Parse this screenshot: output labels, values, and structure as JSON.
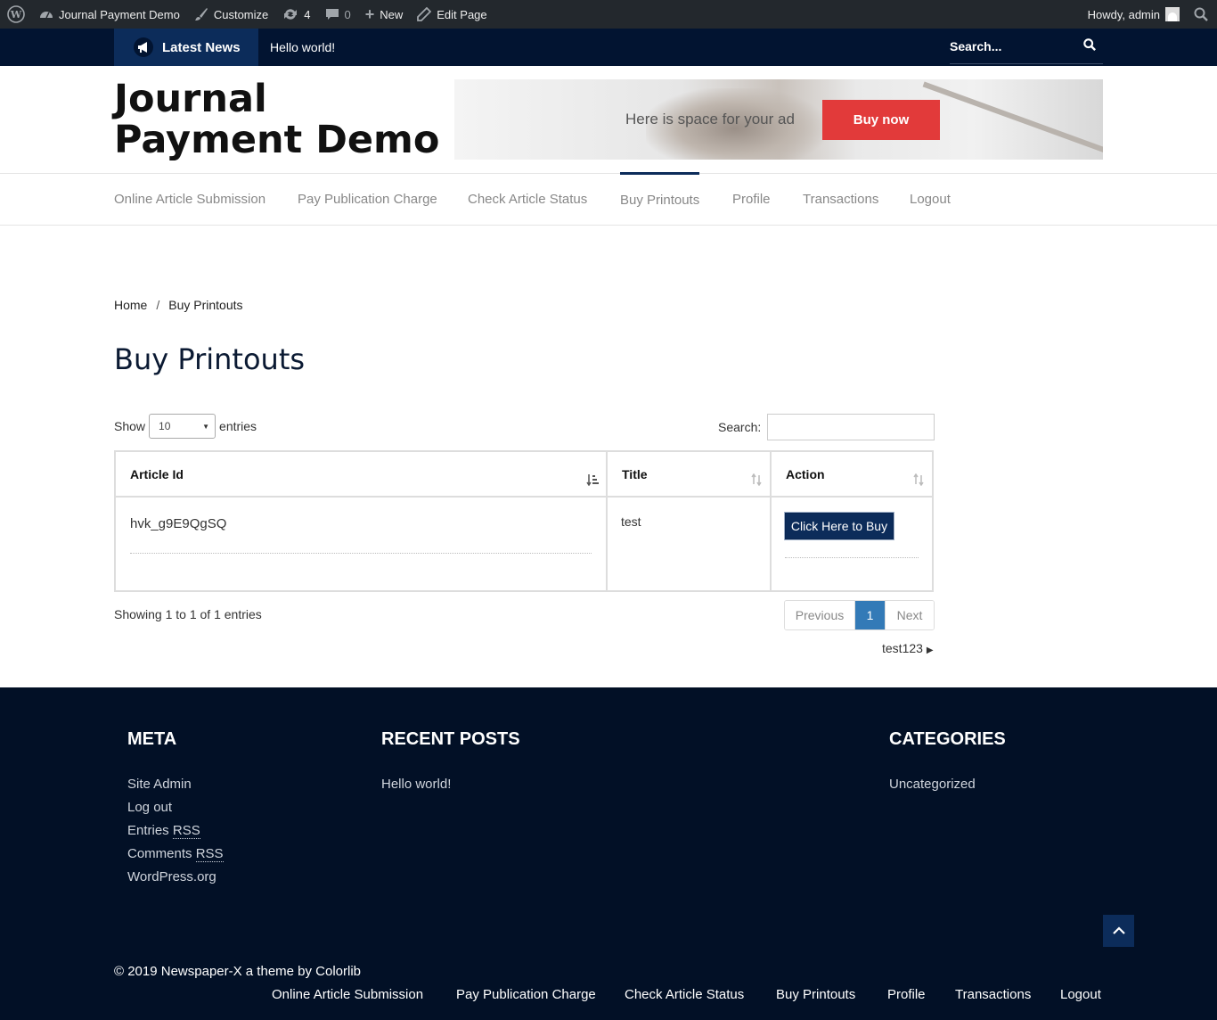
{
  "adminbar": {
    "site_name": "Journal Payment Demo",
    "customize": "Customize",
    "updates": "4",
    "comments": "0",
    "new": "New",
    "edit_page": "Edit Page",
    "howdy": "Howdy, admin"
  },
  "newsbar": {
    "latest_label": "Latest News",
    "ticker_text": "Hello world!",
    "search_placeholder": "Search..."
  },
  "header": {
    "site_title": "Journal Payment Demo",
    "ad_text": "Here is space for your ad",
    "ad_button": "Buy now"
  },
  "nav": [
    "Online Article Submission",
    "Pay Publication Charge",
    "Check Article Status",
    "Buy Printouts",
    "Profile",
    "Transactions",
    "Logout"
  ],
  "breadcrumb": {
    "home": "Home",
    "separator": "/",
    "current": "Buy Printouts"
  },
  "page_title": "Buy Printouts",
  "table_controls": {
    "show_label": "Show",
    "entries_value": "10",
    "entries_label": "entries",
    "search_label": "Search:"
  },
  "table": {
    "headers": [
      "Article Id",
      "Title",
      "Action"
    ],
    "rows": [
      {
        "article_id": "hvk_g9E9QgSQ",
        "title": "test",
        "action": "Click Here to Buy"
      }
    ]
  },
  "pagination": {
    "info": "Showing 1 to 1 of 1 entries",
    "previous": "Previous",
    "current_page": "1",
    "next": "Next"
  },
  "post_nav": {
    "next_post": "test123"
  },
  "footer": {
    "meta": {
      "title": "META",
      "links": [
        "Site Admin",
        "Log out",
        "Entries ",
        "Comments ",
        "WordPress.org"
      ],
      "rss": "RSS"
    },
    "recent_posts": {
      "title": "RECENT POSTS",
      "items": [
        "Hello world!"
      ]
    },
    "categories": {
      "title": "CATEGORIES",
      "items": [
        "Uncategorized"
      ]
    },
    "copyright": "© 2019 Newspaper-X a theme by Colorlib"
  },
  "colors": {
    "navy": "#021431",
    "accent_blue": "#0c2c5a",
    "ad_red": "#e23a3a",
    "pager_blue": "#337ab7"
  }
}
